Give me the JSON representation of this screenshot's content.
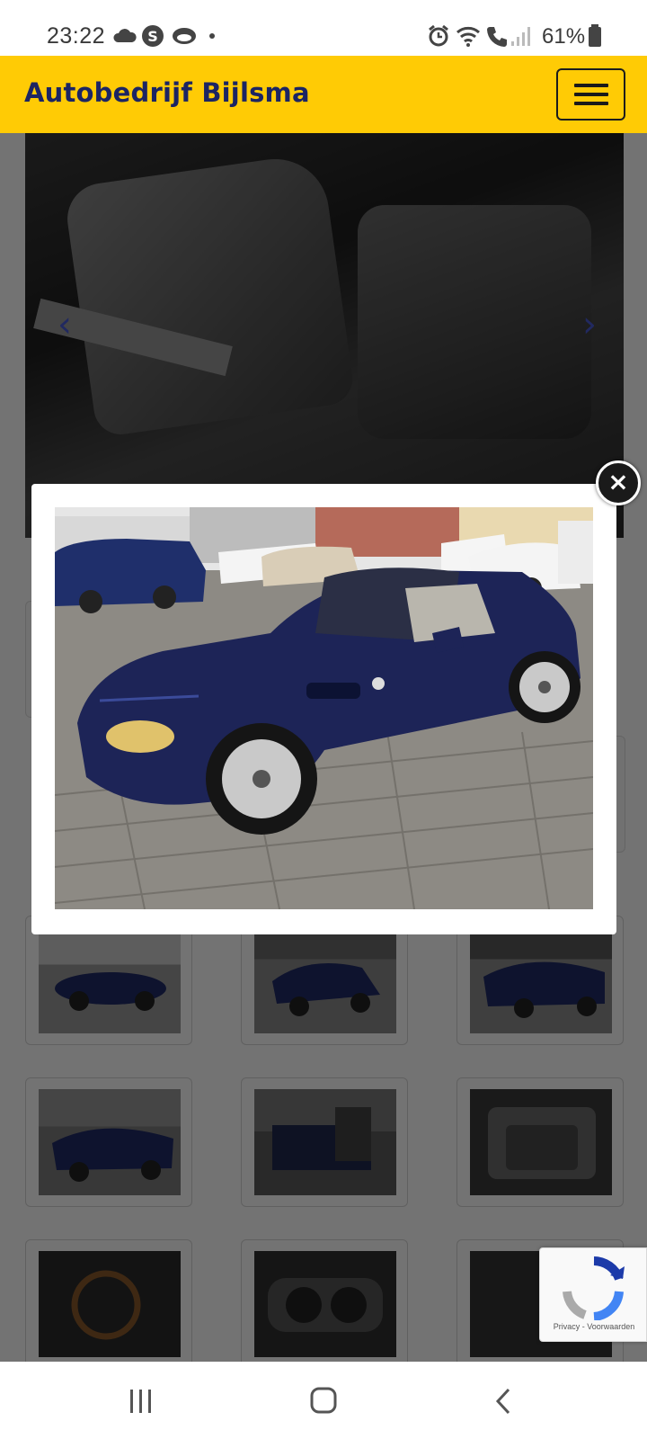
{
  "status_bar": {
    "time": "23:22",
    "battery": "61%",
    "icons": [
      "cloud-icon",
      "s-app-icon",
      "weather-icon",
      "dot-icon",
      "alarm-icon",
      "wifi-icon",
      "call-icon",
      "signal-icon",
      "battery-icon"
    ]
  },
  "header": {
    "brand": "Autobedrijf Bijlsma",
    "menu_icon": "hamburger-icon",
    "background": "#ffcb05",
    "brand_color": "#1c2563"
  },
  "lightbox": {
    "close_symbol": "×",
    "image": "photo of dark blue BMW Z3 roadster with hardtop on paved parking lot"
  },
  "recaptcha": {
    "label": "Privacy - Voorwaarden"
  },
  "nav": {
    "icons": [
      "recent-apps-icon",
      "home-icon",
      "back-icon"
    ]
  }
}
